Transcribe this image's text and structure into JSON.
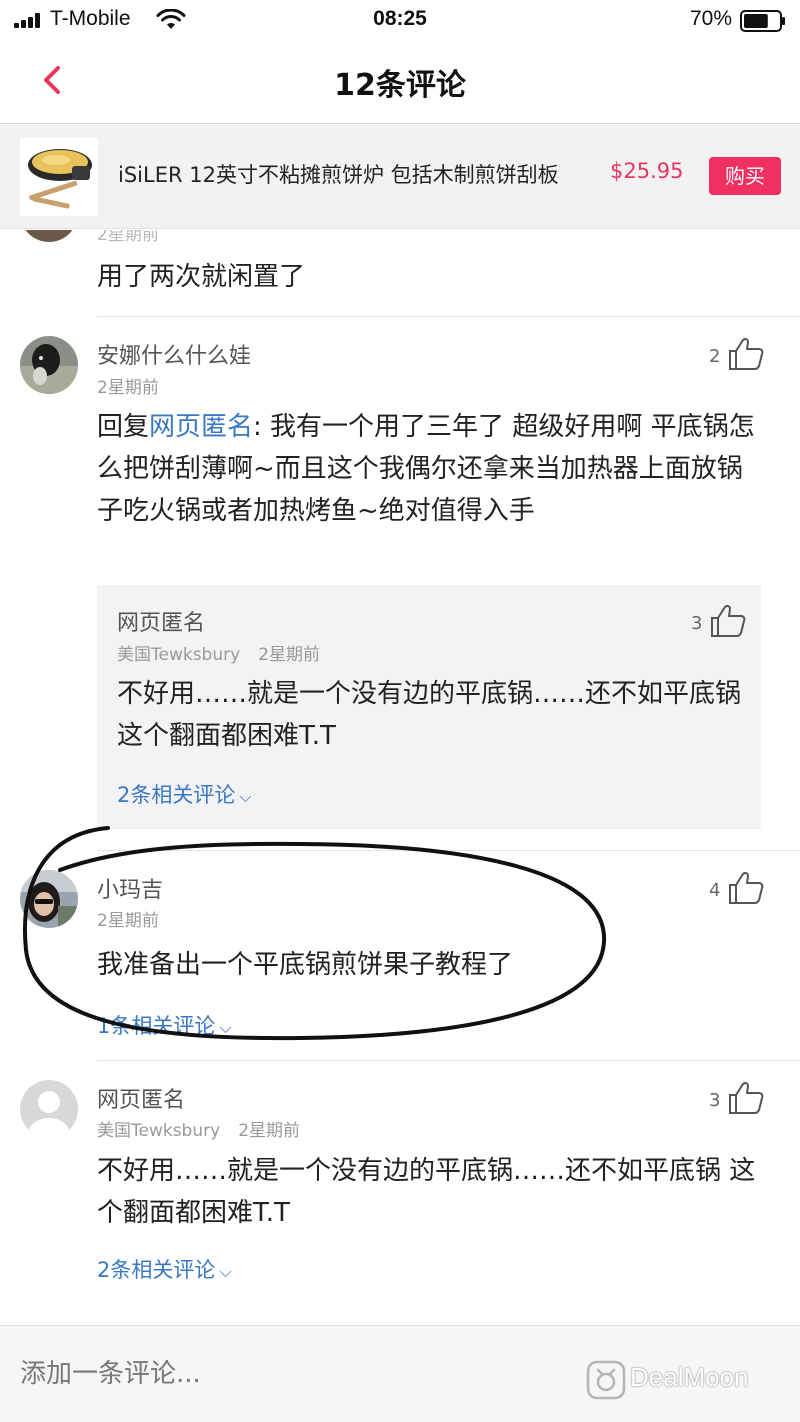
{
  "status_bar": {
    "carrier": "T-Mobile",
    "time": "08:25",
    "battery_percent": "70%",
    "battery_level": 0.7
  },
  "nav": {
    "title": "12条评论",
    "back_icon": "chevron-left-icon"
  },
  "product": {
    "name": "iSiLER 12英寸不粘摊煎饼炉 包括木制煎饼刮板",
    "price": "$25.95",
    "buy_label": "购买"
  },
  "comments": [
    {
      "meta": "2星期前",
      "text": "用了两次就闲置了"
    },
    {
      "username": "安娜什么什么娃",
      "time": "2星期前",
      "likes": "2",
      "reply_prefix": "回复",
      "reply_to": "网页匿名",
      "text": ": 我有一个用了三年了 超级好用啊 平底锅怎么把饼刮薄啊~而且这个我偶尔还拿来当加热器上面放锅子吃火锅或者加热烤鱼~绝对值得入手",
      "quoted": {
        "username": "网页匿名",
        "location": "美国Tewksbury",
        "time": "2星期前",
        "likes": "3",
        "text": "不好用……就是一个没有边的平底锅……还不如平底锅 这个翻面都困难T.T",
        "related": "2条相关评论"
      }
    },
    {
      "username": "小玛吉",
      "time": "2星期前",
      "likes": "4",
      "text": "我准备出一个平底锅煎饼果子教程了",
      "related": "1条相关评论"
    },
    {
      "username": "网页匿名",
      "location": "美国Tewksbury",
      "time": "2星期前",
      "likes": "3",
      "text": "不好用……就是一个没有边的平底锅……还不如平底锅 这个翻面都困难T.T",
      "related": "2条相关评论"
    }
  ],
  "input": {
    "placeholder": "添加一条评论..."
  },
  "watermark": {
    "text": "DealMoon"
  },
  "colors": {
    "accent": "#f0305f",
    "price": "#e8365d",
    "link": "#3a78c3"
  }
}
